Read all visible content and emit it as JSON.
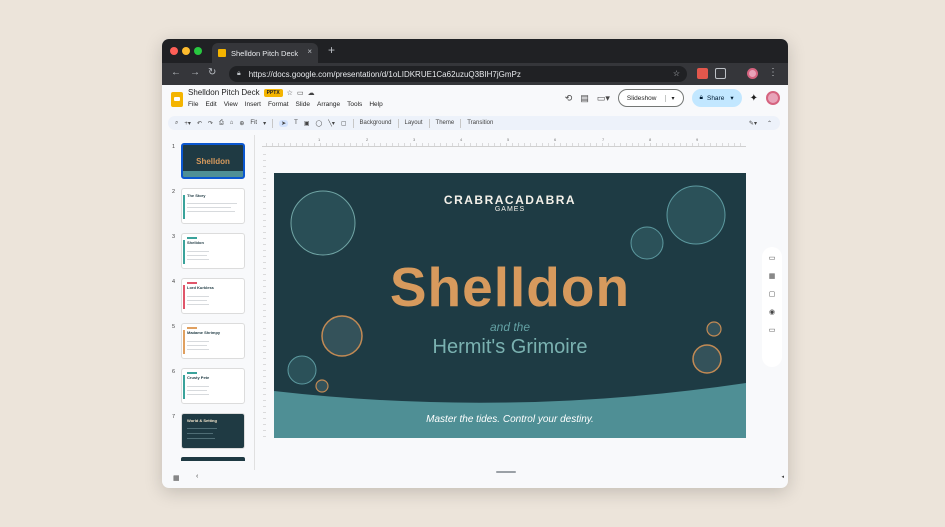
{
  "browser": {
    "tab_title": "Shelldon Pitch Deck",
    "tab_close": "×",
    "new_tab": "+",
    "url": "https://docs.google.com/presentation/d/1oLIDKRUE1Ca62uzuQ3BIH7jGmPz",
    "back": "←",
    "forward": "→",
    "reload": "↻"
  },
  "doc": {
    "title": "Shelldon Pitch Deck",
    "badge": "PPTX",
    "menu": [
      "File",
      "Edit",
      "View",
      "Insert",
      "Format",
      "Slide",
      "Arrange",
      "Tools",
      "Help"
    ],
    "slideshow_label": "Slideshow",
    "share_label": "Share"
  },
  "toolbar": {
    "zoom": "Fit",
    "background": "Background",
    "layout": "Layout",
    "theme": "Theme",
    "transition": "Transition"
  },
  "filmstrip": {
    "slides": [
      {
        "num": "1",
        "title": "Shelldon",
        "dark": true,
        "selected": true
      },
      {
        "num": "2",
        "title": "The Story",
        "accent": "#e6b76e"
      },
      {
        "num": "3",
        "title": "Shelldon",
        "accent": "#3aa39b"
      },
      {
        "num": "4",
        "title": "Lord Kurkless",
        "accent": "#e0566a"
      },
      {
        "num": "5",
        "title": "Madame Shrimpy",
        "accent": "#e0a060"
      },
      {
        "num": "6",
        "title": "Crusty Pete",
        "accent": "#3aa39b"
      },
      {
        "num": "7",
        "title": "World & Setting",
        "dark": true
      }
    ]
  },
  "slide": {
    "company_line1": "CRABRACADABRA",
    "company_line2": "GAMES",
    "title": "Shelldon",
    "subtitle_small": "and the",
    "subtitle_large": "Hermit's Grimoire",
    "tagline": "Master the tides. Control your destiny."
  },
  "ruler": {
    "ticks": [
      "1",
      "2",
      "3",
      "4",
      "5",
      "6",
      "7",
      "8",
      "9"
    ]
  },
  "colors": {
    "slide_bg": "#1e3b44",
    "title_orange": "#d79a5d",
    "teal_band": "#4f8f95",
    "accent_blue": "#0b57d0"
  }
}
